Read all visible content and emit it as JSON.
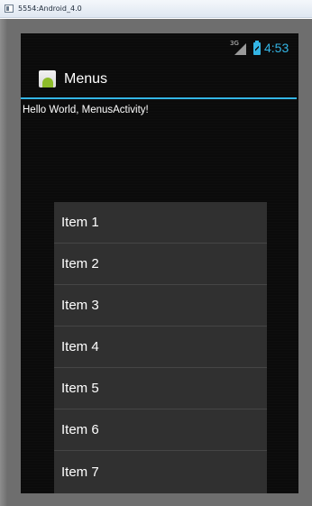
{
  "window": {
    "title": "5554:Android_4.0"
  },
  "status_bar": {
    "network_type": "3G",
    "signal_icon": "signal-icon",
    "battery_icon": "battery-charging-icon",
    "time": "4:53"
  },
  "action_bar": {
    "app_icon": "android-app-icon",
    "title": "Menus"
  },
  "content": {
    "hello_text": "Hello World, MenusActivity!"
  },
  "menu": {
    "items": [
      {
        "label": "Item 1"
      },
      {
        "label": "Item 2"
      },
      {
        "label": "Item 3"
      },
      {
        "label": "Item 4"
      },
      {
        "label": "Item 5"
      },
      {
        "label": "Item 6"
      },
      {
        "label": "Item 7"
      }
    ]
  },
  "colors": {
    "accent": "#33b5e5",
    "screen_background": "#0b0b0b",
    "menu_background": "#303030",
    "emulator_frame": "#6e6e6e"
  }
}
